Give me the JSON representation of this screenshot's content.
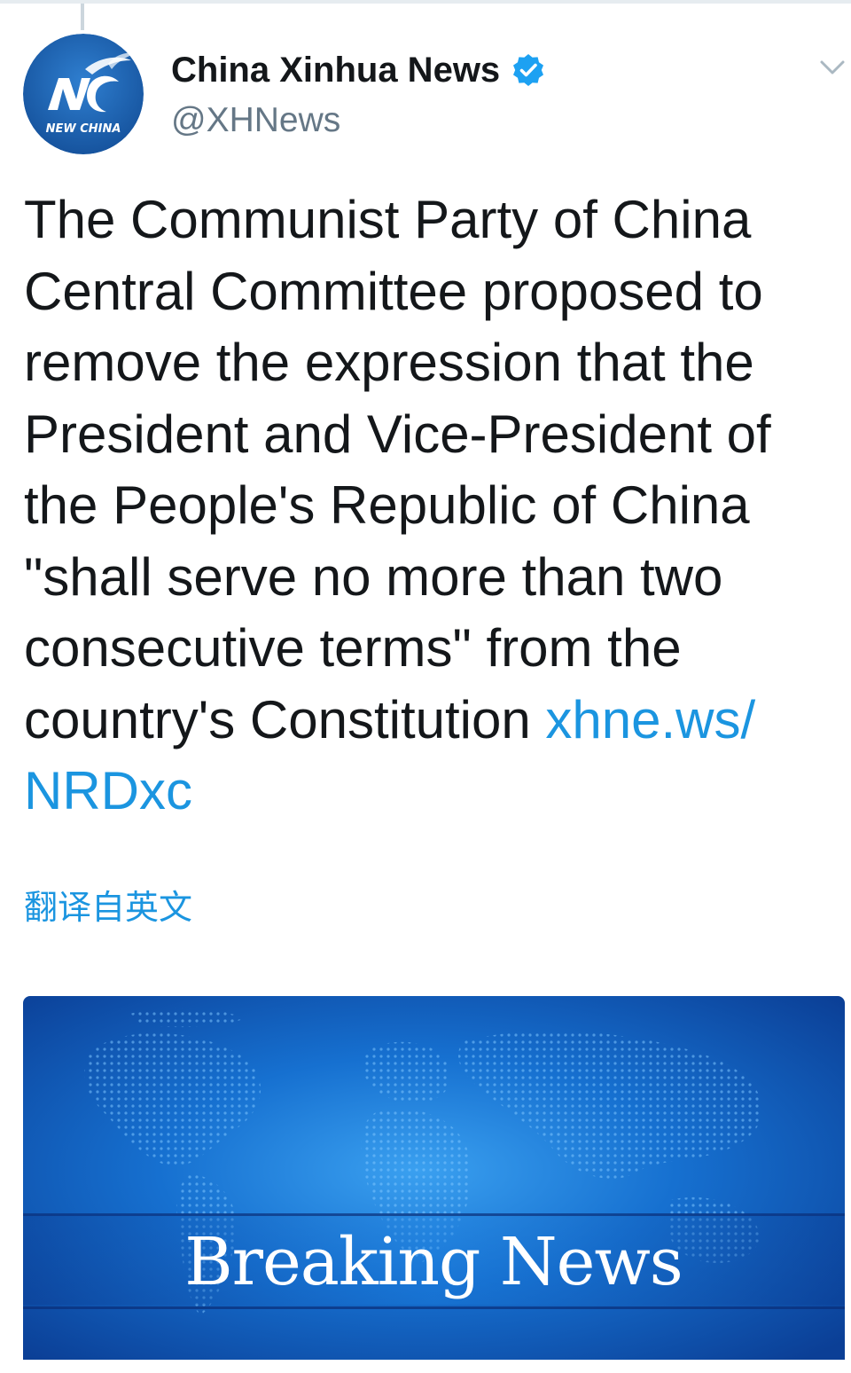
{
  "account": {
    "avatar": {
      "label": "NEW CHINA",
      "icon": "xinhua-logo-icon"
    },
    "display_name": "China Xinhua News",
    "verified_icon": "verified-badge-icon",
    "handle": "@XHNews",
    "menu_icon": "chevron-down-icon"
  },
  "tweet": {
    "lines": [
      "The Communist Party of China",
      "Central Committee proposed to",
      "remove the expression that the",
      "President and Vice-President of",
      "the People's Republic of China",
      "\"shall serve no more than two",
      "consecutive terms\" from the",
      "country's Constitution "
    ],
    "link_part1": "xhne.ws/",
    "link_part2": "NRDxc",
    "translate_label": "翻译自英文"
  },
  "media": {
    "caption": "Breaking News"
  },
  "colors": {
    "link": "#1b95e0",
    "verified": "#1da1f2",
    "text": "#14171a",
    "secondary": "#657786",
    "avatar_blue": "#1f5fa8",
    "media_blue": "#0a56b8"
  }
}
